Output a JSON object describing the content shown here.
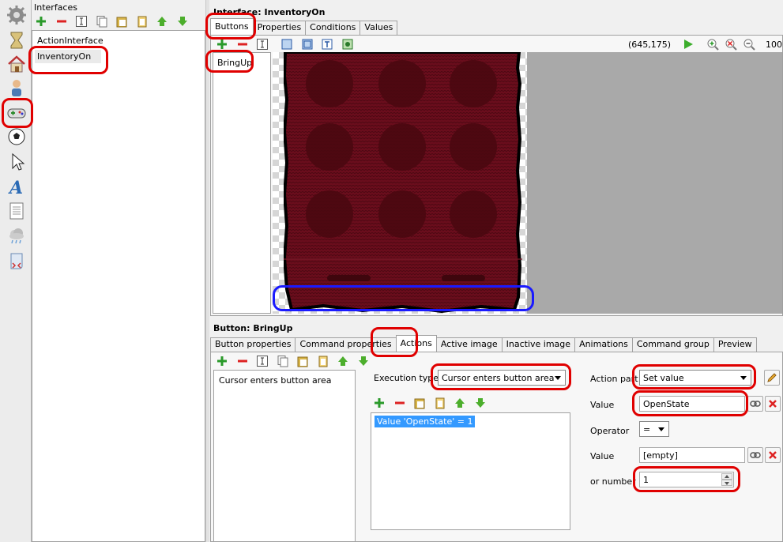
{
  "interfaces_panel": {
    "title": "Interfaces",
    "items": [
      "ActionInterface",
      "InventoryOn"
    ]
  },
  "interface_panel": {
    "title": "Interface: InventoryOn",
    "tabs": [
      "Buttons",
      "Properties",
      "Conditions",
      "Values"
    ],
    "buttons_list": [
      "BringUp"
    ],
    "coords": "(645,175)",
    "zoom": "100"
  },
  "button_panel": {
    "title": "Button: BringUp",
    "tabs": [
      "Button properties",
      "Command properties",
      "Actions",
      "Active image",
      "Inactive image",
      "Animations",
      "Command group",
      "Preview"
    ],
    "events": [
      "Cursor enters button area"
    ],
    "execution_type_label": "Execution type",
    "execution_type_value": "Cursor enters button area",
    "actions": [
      "Value 'OpenState' = 1"
    ],
    "action_part_label": "Action part",
    "action_part_value": "Set value",
    "value_label": "Value",
    "value_value": "OpenState",
    "operator_label": "Operator",
    "operator_value": "=",
    "value2_label": "Value",
    "value2_value": "[empty]",
    "or_number_label": "or number",
    "or_number_value": "1"
  },
  "colors": {
    "highlight_red": "#e00000",
    "highlight_blue": "#1a1aff",
    "selection": "#3399ff",
    "inventory_fabric": "#6a0d1c"
  }
}
